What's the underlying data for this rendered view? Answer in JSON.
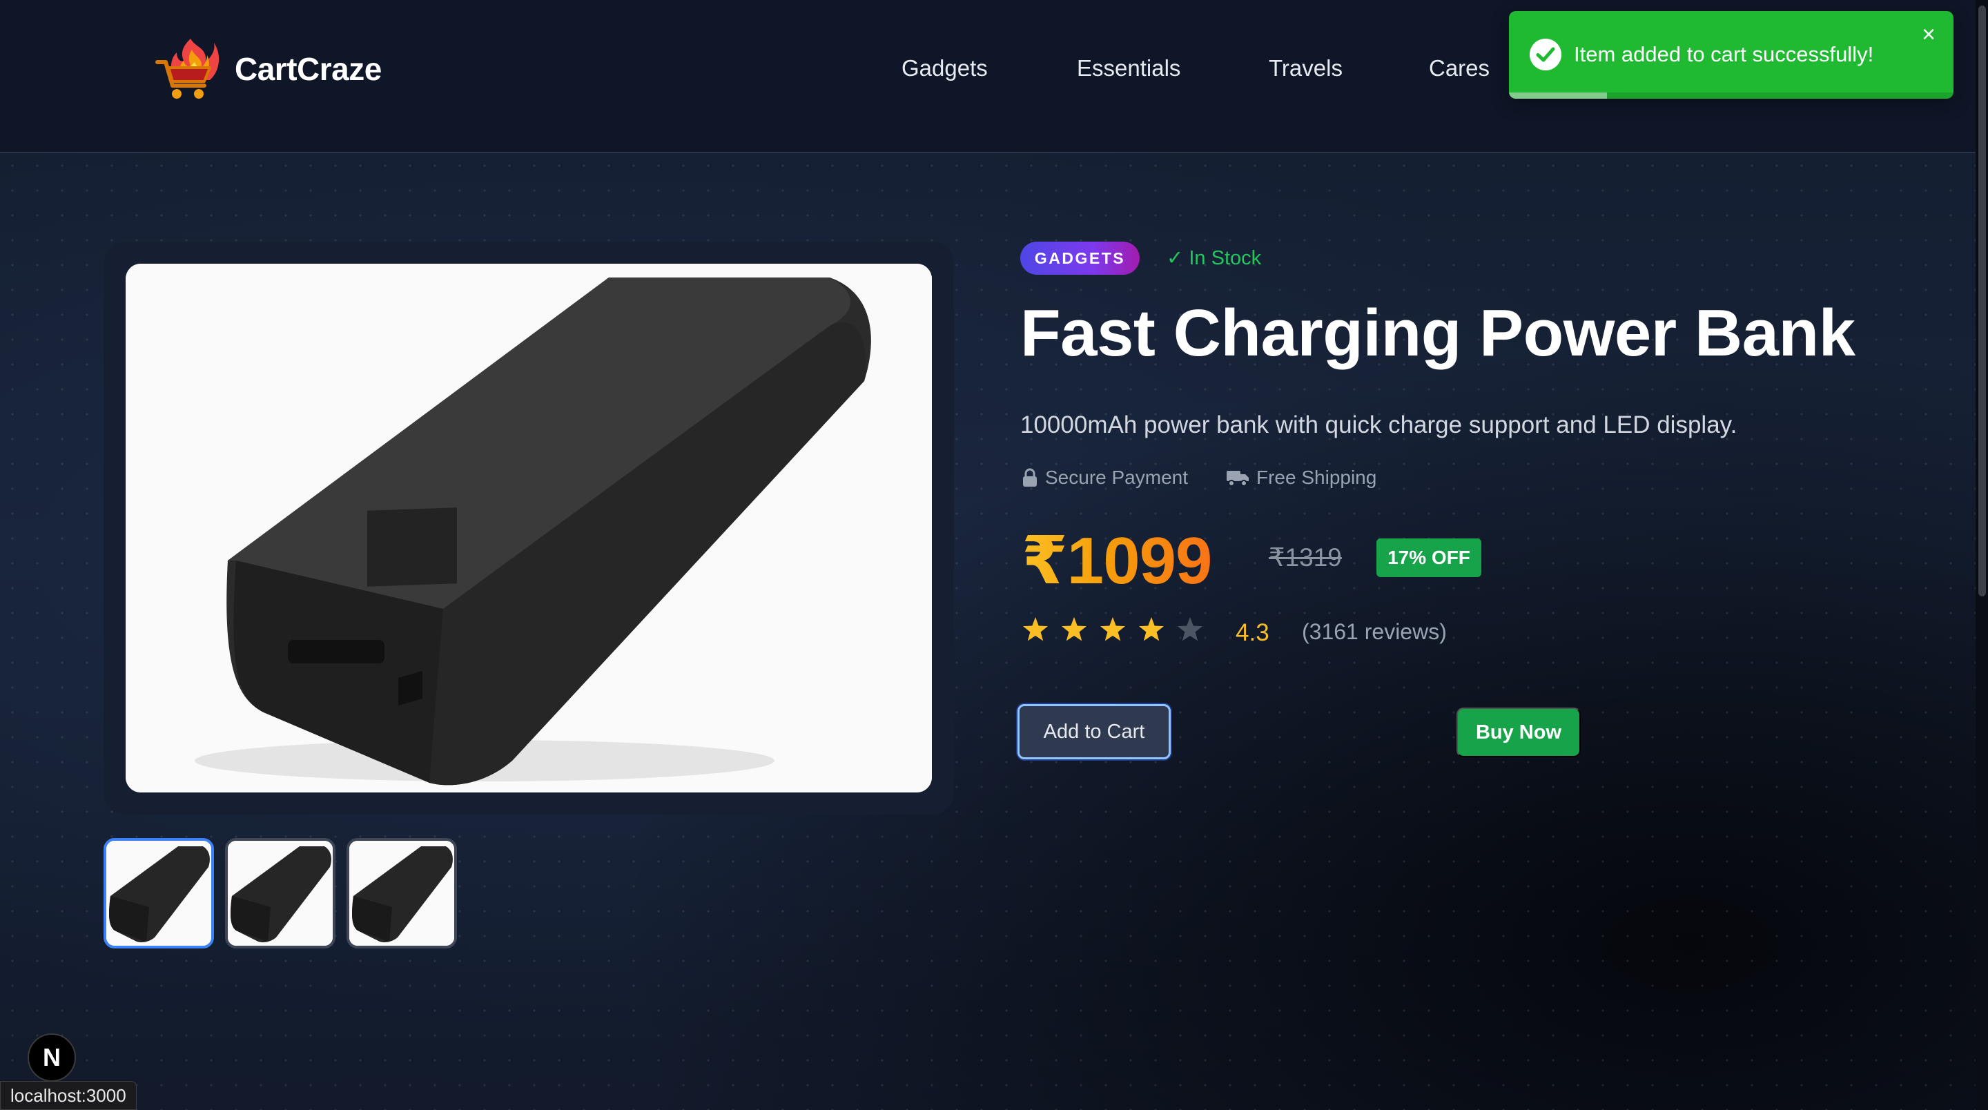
{
  "brand": {
    "name": "CartCraze"
  },
  "nav": {
    "items": [
      {
        "label": "Gadgets"
      },
      {
        "label": "Essentials"
      },
      {
        "label": "Travels"
      },
      {
        "label": "Cares"
      }
    ]
  },
  "toast": {
    "message": "Item added to cart successfully!",
    "close_icon": "×",
    "progress": 0.22,
    "color": "#1fba32"
  },
  "product": {
    "category": "GADGETS",
    "stock_status": "✓ In Stock",
    "title": "Fast Charging Power Bank",
    "description": "10000mAh power bank with quick charge support and LED display.",
    "features": [
      {
        "icon": "lock-icon",
        "label": "Secure Payment"
      },
      {
        "icon": "truck-icon",
        "label": "Free Shipping"
      }
    ],
    "price": "₹1099",
    "original_price": "₹1319",
    "discount": "17% OFF",
    "rating": "4.3",
    "rating_value": 4.3,
    "stars_filled": 4,
    "stars_total": 5,
    "reviews": "(3161 reviews)",
    "thumbnails": 3,
    "active_thumbnail": 0
  },
  "actions": {
    "add_to_cart": "Add to Cart",
    "buy_now": "Buy Now"
  },
  "dev": {
    "badge": "N",
    "status_url": "localhost:3000"
  },
  "colors": {
    "accent_green": "#16a34a",
    "price_gold": "#fbbf24",
    "badge_gradient_start": "#4f46e5",
    "badge_gradient_end": "#a21caf",
    "background": "#0f1626"
  }
}
